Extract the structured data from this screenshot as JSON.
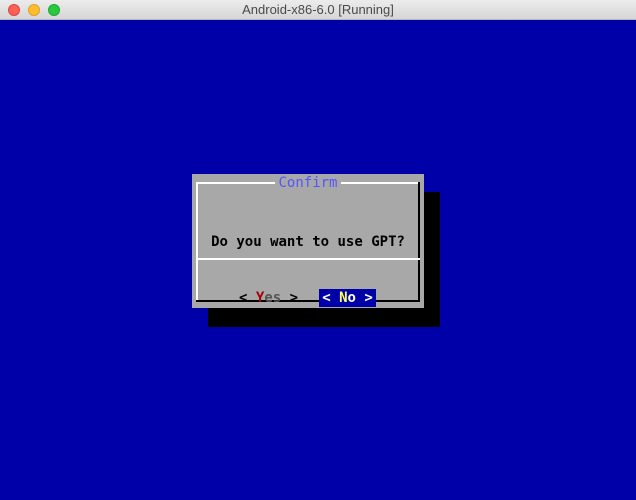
{
  "window": {
    "title": "Android-x86-6.0 [Running]"
  },
  "colors": {
    "screen_bg": "#0000a8",
    "dialog_bg": "#a8a8a8",
    "dialog_title": "#5555ff",
    "hotkey_red": "#a80000",
    "selected_bg": "#0000a8",
    "selected_hotkey": "#ffff55"
  },
  "dialog": {
    "title": "Confirm",
    "message": "Do you want to use GPT?",
    "buttons": {
      "yes": {
        "left_bracket": "<",
        "hotkey": "Y",
        "rest": "es",
        "right_bracket": ">"
      },
      "no": {
        "left_bracket": "<",
        "hotkey": "N",
        "rest": "o",
        "right_bracket": ">",
        "selected": true
      }
    }
  },
  "icons": [
    "close-traffic-light-icon",
    "minimize-traffic-light-icon",
    "zoom-traffic-light-icon"
  ]
}
